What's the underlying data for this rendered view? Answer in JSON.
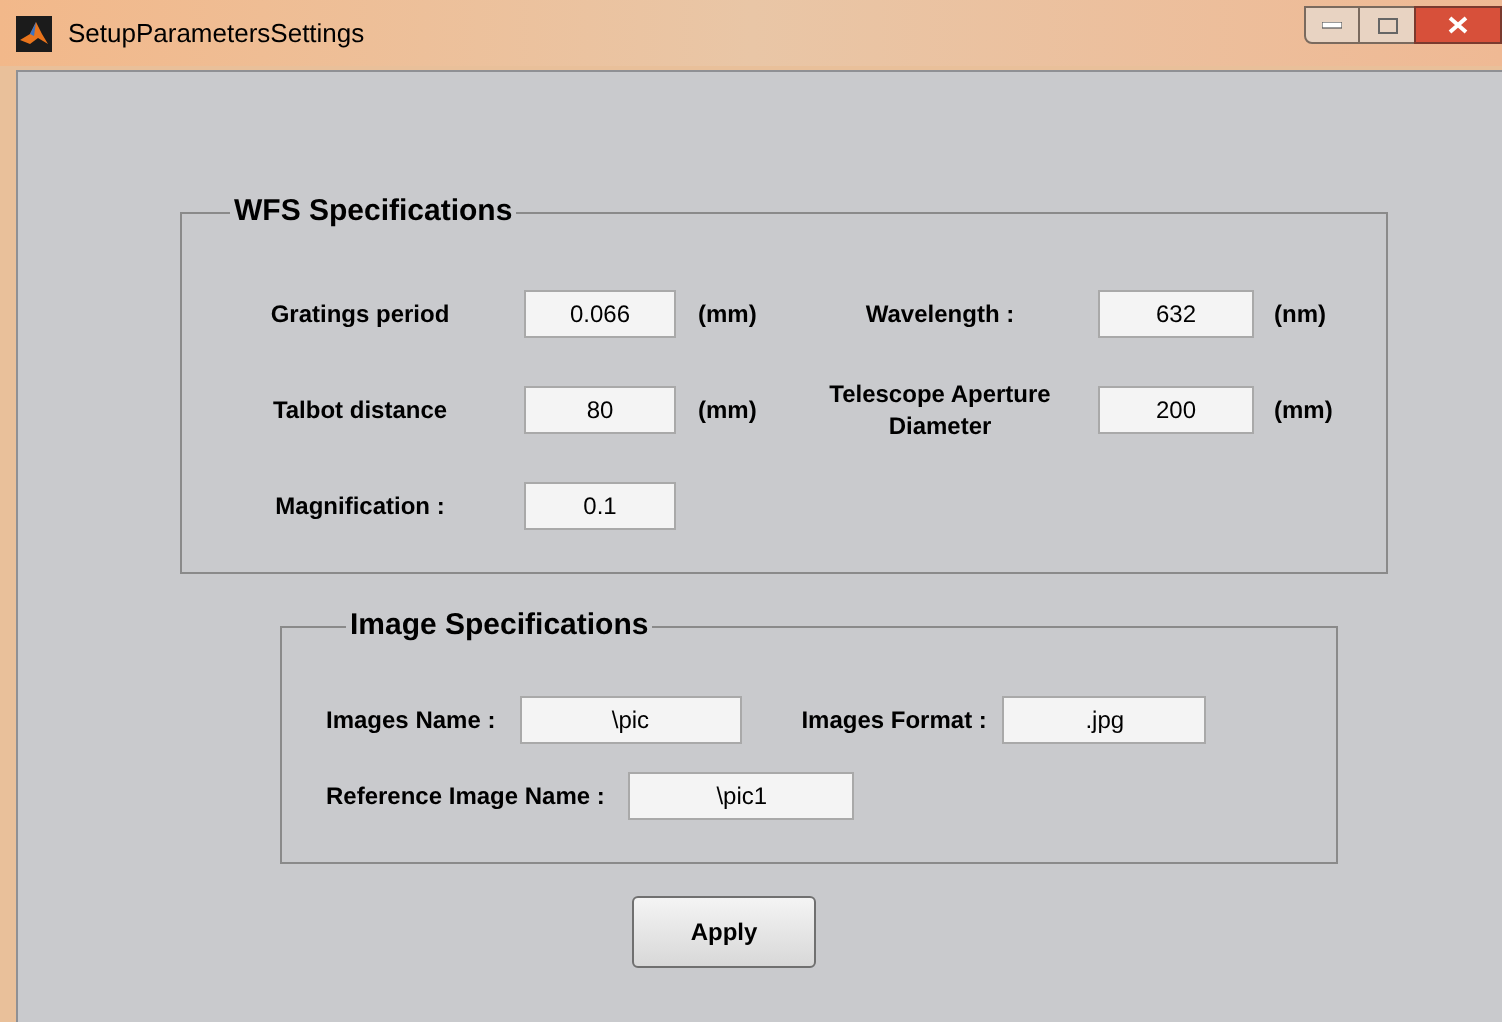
{
  "window": {
    "title": "SetupParametersSettings"
  },
  "wfs_panel": {
    "title": "WFS Specifications",
    "rows": [
      [
        {
          "label": "Gratings period",
          "value": "0.066",
          "unit": "(mm)"
        },
        {
          "label": "Wavelength :",
          "value": "632",
          "unit": "(nm)"
        }
      ],
      [
        {
          "label": "Talbot distance",
          "value": "80",
          "unit": "(mm)"
        },
        {
          "label": "Telescope Aperture Diameter",
          "value": "200",
          "unit": "(mm)"
        }
      ],
      [
        {
          "label": "Magnification :",
          "value": "0.1"
        }
      ]
    ]
  },
  "image_panel": {
    "title": "Image Specifications",
    "rows": [
      [
        {
          "label": "Images Name :",
          "value": "\\pic"
        },
        {
          "label": "Images Format :",
          "value": ".jpg"
        }
      ],
      [
        {
          "label": "Reference Image Name :",
          "value": "\\pic1"
        }
      ]
    ]
  },
  "apply_button": {
    "label": "Apply"
  }
}
